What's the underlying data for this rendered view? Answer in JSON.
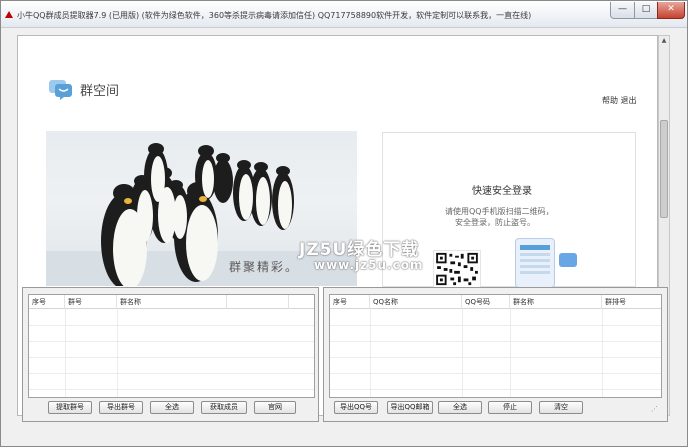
{
  "window": {
    "title": "小牛QQ群成员提取器7.9 (已用版)     (软件为绿色软件，360等杀提示病毒请添加信任) QQ717758890软件开发，软件定制可以联系我，一直在线)",
    "minimize": "—",
    "maximize": "□",
    "close": "✕"
  },
  "header": {
    "logo_text": "群空间",
    "corner_link": "帮助 退出"
  },
  "banner": {
    "slogan": "群聚精彩。"
  },
  "login": {
    "title": "快速安全登录",
    "hint_line1": "请使用QQ手机版扫描二维码，",
    "hint_line2": "安全登录，防止盗号。"
  },
  "watermark": {
    "line1": "JZ5U绿色下载",
    "line2": "www.jz5u.com"
  },
  "left_panel": {
    "columns": [
      "序号",
      "群号",
      "群名称"
    ],
    "buttons": [
      "提取群号",
      "导出群号",
      "全选",
      "获取成员",
      "官网"
    ]
  },
  "right_panel": {
    "columns": [
      "序号",
      "QQ名称",
      "QQ号码",
      "群名称",
      "群排号"
    ],
    "buttons": [
      "导出QQ号",
      "导出QQ邮箱",
      "全选",
      "停止",
      "清空"
    ]
  },
  "icons": {
    "app": "app-triangle-icon",
    "logo": "chat-bubble-icon"
  },
  "colors": {
    "accent": "#5aa0d8",
    "close_red": "#c6432f",
    "logo_blue": "#7db7e6"
  }
}
